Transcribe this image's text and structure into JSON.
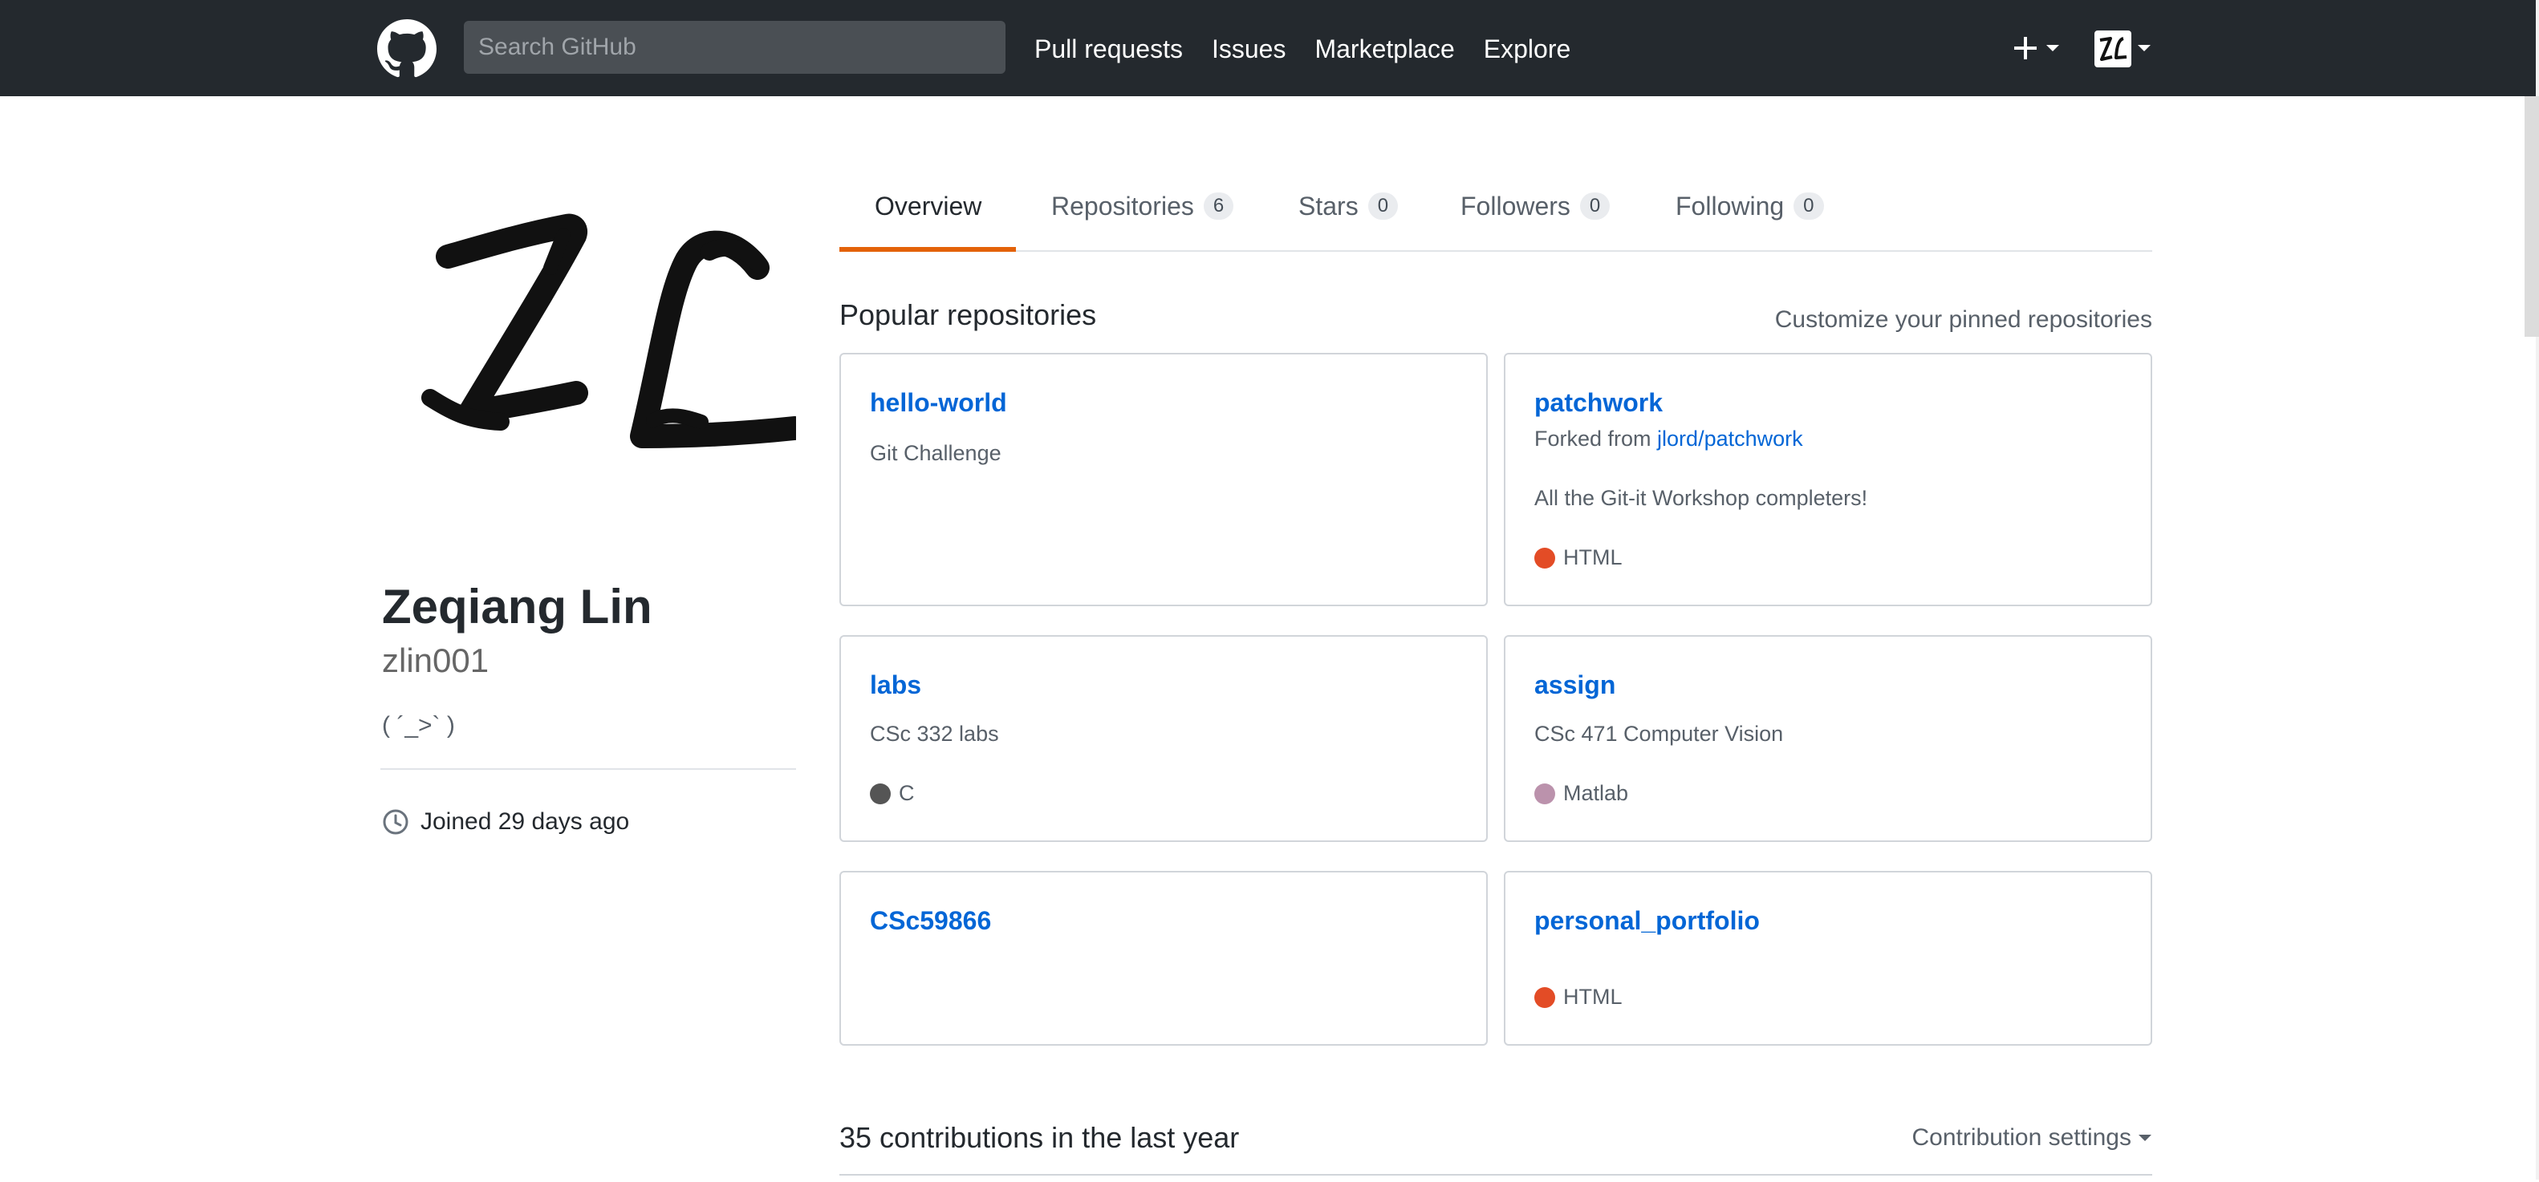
{
  "header": {
    "search_placeholder": "Search GitHub",
    "nav": [
      "Pull requests",
      "Issues",
      "Marketplace",
      "Explore"
    ],
    "plus_symbol": "+"
  },
  "profile": {
    "fullname": "Zeqiang Lin",
    "username": "zlin001",
    "bio": "( ´_>` )",
    "joined": "Joined 29 days ago"
  },
  "tabs": [
    {
      "label": "Overview",
      "count": ""
    },
    {
      "label": "Repositories",
      "count": "6"
    },
    {
      "label": "Stars",
      "count": "0"
    },
    {
      "label": "Followers",
      "count": "0"
    },
    {
      "label": "Following",
      "count": "0"
    }
  ],
  "popular": {
    "title": "Popular repositories",
    "customize": "Customize your pinned repositories",
    "repos": [
      {
        "name": "hello-world",
        "forked_prefix": "",
        "forked_from": "",
        "description": "Git Challenge",
        "language": "",
        "lang_color": ""
      },
      {
        "name": "patchwork",
        "forked_prefix": "Forked from ",
        "forked_from": "jlord/patchwork",
        "description": "All the Git-it Workshop completers!",
        "language": "HTML",
        "lang_color": "#e34c26"
      },
      {
        "name": "labs",
        "forked_prefix": "",
        "forked_from": "",
        "description": "CSc 332 labs",
        "language": "C",
        "lang_color": "#555555"
      },
      {
        "name": "assign",
        "forked_prefix": "",
        "forked_from": "",
        "description": "CSc 471 Computer Vision",
        "language": "Matlab",
        "lang_color": "#bb92ac"
      },
      {
        "name": "CSc59866",
        "forked_prefix": "",
        "forked_from": "",
        "description": "",
        "language": "",
        "lang_color": ""
      },
      {
        "name": "personal_portfolio",
        "forked_prefix": "",
        "forked_from": "",
        "description": "",
        "language": "HTML",
        "lang_color": "#e34c26"
      }
    ]
  },
  "contributions": {
    "title": "35 contributions in the last year",
    "settings": "Contribution settings"
  },
  "colors": {
    "header_bg": "#24292e",
    "link": "#0366d6",
    "tab_accent": "#e36209"
  },
  "icons": {
    "logo": "github-octocat-icon",
    "plus": "plus-icon",
    "caret": "caret-down-icon",
    "clock": "clock-icon"
  }
}
